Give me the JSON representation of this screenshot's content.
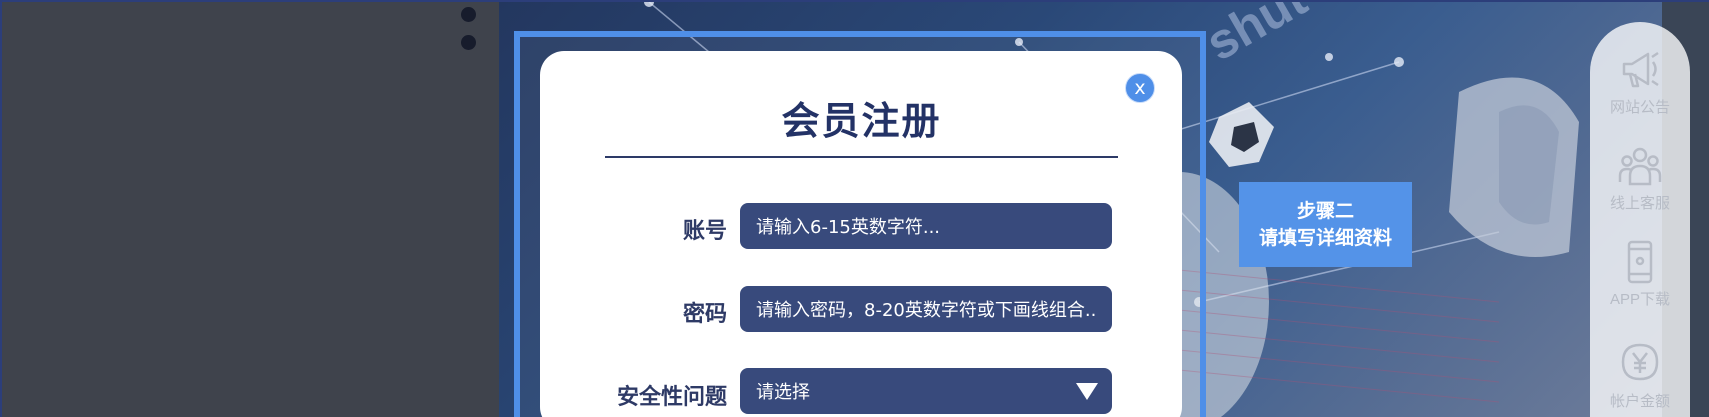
{
  "modal": {
    "close_label": "x",
    "title": "会员注册",
    "fields": [
      {
        "label": "账号",
        "placeholder": "请输入6-15英数字符..."
      },
      {
        "label": "密码",
        "placeholder": "请输入密码，8-20英数字符或下画线组合.."
      },
      {
        "label": "安全性问题",
        "selected": "请选择"
      }
    ]
  },
  "step": {
    "line1": "步骤二",
    "line2": "请填写详细资料"
  },
  "banner": {
    "watermark": "shut"
  },
  "side_nav": [
    {
      "label": "网站公告",
      "icon": "megaphone-icon"
    },
    {
      "label": "线上客服",
      "icon": "customer-service-icon"
    },
    {
      "label": "APP下载",
      "icon": "mobile-phone-icon"
    },
    {
      "label": "帐户金额",
      "icon": "yen-coin-icon"
    }
  ],
  "colors": {
    "accent": "#4f8fe8",
    "input_bg": "#384a7c",
    "title": "#233266",
    "page_bg": "#3f434c"
  }
}
